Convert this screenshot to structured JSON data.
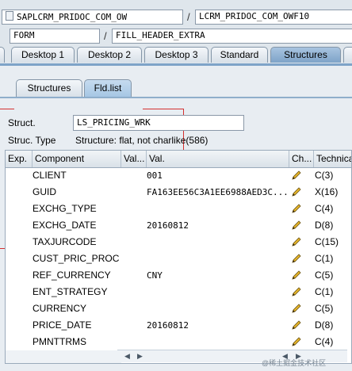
{
  "header": {
    "program": "SAPLCRM_PRIDOC_COM_OW",
    "include": "LCRM_PRIDOC_COM_OWF10",
    "event_type": "FORM",
    "event_name": "FILL_HEADER_EXTRA"
  },
  "desktop_tabs": [
    {
      "label": "Desktop 1",
      "active": false
    },
    {
      "label": "Desktop 2",
      "active": false
    },
    {
      "label": "Desktop 3",
      "active": false
    },
    {
      "label": "Standard",
      "active": false
    },
    {
      "label": "Structures",
      "active": true
    }
  ],
  "inner_tabs": [
    {
      "label": "Structures",
      "active": false
    },
    {
      "label": "Fld.list",
      "active": true
    }
  ],
  "struct": {
    "label": "Struct.",
    "value": "LS_PRICING_WRK",
    "type_label": "Struc. Type",
    "type_value": "Structure: flat, not charlike(586)"
  },
  "table": {
    "headers": [
      "Exp.",
      "Component",
      "Val...",
      "Val.",
      "Ch...",
      "Technica"
    ],
    "rows": [
      {
        "component": "CLIENT",
        "value": "001",
        "tech": "C(3)"
      },
      {
        "component": "GUID",
        "value": "FA163EE56C3A1EE6988AED3C...",
        "tech": "X(16)"
      },
      {
        "component": "EXCHG_TYPE",
        "value": "",
        "tech": "C(4)"
      },
      {
        "component": "EXCHG_DATE",
        "value": "20160812",
        "tech": "D(8)"
      },
      {
        "component": "TAXJURCODE",
        "value": "",
        "tech": "C(15)"
      },
      {
        "component": "CUST_PRIC_PROC",
        "value": "",
        "tech": "C(1)"
      },
      {
        "component": "REF_CURRENCY",
        "value": "CNY",
        "tech": "C(5)"
      },
      {
        "component": "ENT_STRATEGY",
        "value": "",
        "tech": "C(1)"
      },
      {
        "component": "CURRENCY",
        "value": "",
        "tech": "C(5)"
      },
      {
        "component": "PRICE_DATE",
        "value": "20160812",
        "tech": "D(8)"
      },
      {
        "component": "PMNTTRMS",
        "value": "",
        "tech": "C(4)"
      }
    ]
  },
  "icons": {
    "edit": "pencil-icon",
    "scroll_left": "arrow-left-icon",
    "scroll_right": "arrow-right-icon"
  },
  "colors": {
    "active_tab": "#7ea3c8",
    "highlight": "#d43030"
  },
  "watermark": "@稀土掘金技术社区"
}
